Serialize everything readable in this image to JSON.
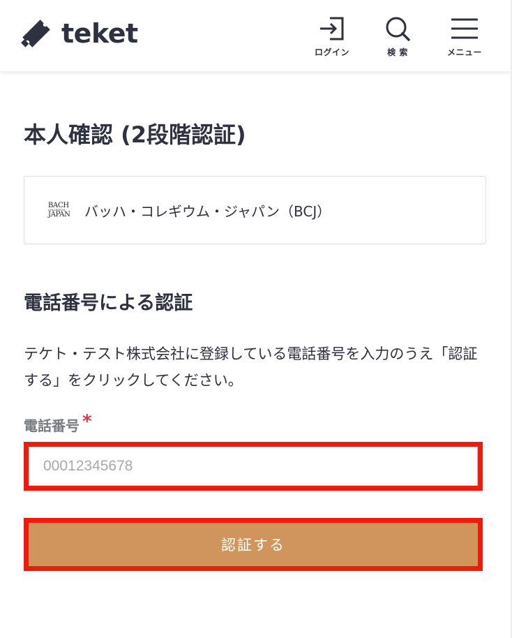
{
  "header": {
    "logo_text": "teket",
    "nav": {
      "login_label": "ログイン",
      "search_label": "検 索",
      "menu_label": "メニュー"
    }
  },
  "page": {
    "title": "本人確認 (2段階認証)"
  },
  "organization": {
    "logo_top": "BACH",
    "logo_middle": "COLLEGIUM",
    "logo_bottom": "JAPAN",
    "name": "バッハ・コレギウム・ジャパン（BCJ）"
  },
  "verification": {
    "section_title": "電話番号による認証",
    "instructions": "テケト・テスト株式会社に登録している電話番号を入力のうえ「認証する」をクリックしてください。",
    "phone_label": "電話番号",
    "required_mark": "*",
    "phone_placeholder": "00012345678",
    "phone_value": "",
    "submit_label": "認証する"
  },
  "colors": {
    "accent": "#cf955d",
    "required": "#e0344b",
    "highlight": "#f21a0a",
    "text": "#2d3140"
  }
}
